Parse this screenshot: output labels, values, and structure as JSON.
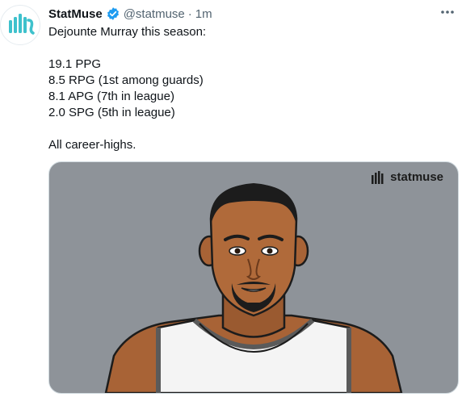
{
  "account": {
    "name": "StatMuse",
    "handle": "@statmuse",
    "separator": "·",
    "time": "1m"
  },
  "tweet": {
    "lines": [
      "Dejounte Murray this season:",
      "",
      "19.1 PPG",
      "8.5 RPG (1st among guards)",
      "8.1 APG (7th in league)",
      "2.0 SPG (5th in league)",
      "",
      "All career-highs."
    ]
  },
  "media": {
    "brand": "statmuse"
  },
  "colors": {
    "brand_teal": "#3ec1cc",
    "verified_blue": "#1d9bf0",
    "media_bg": "#8e9399"
  }
}
